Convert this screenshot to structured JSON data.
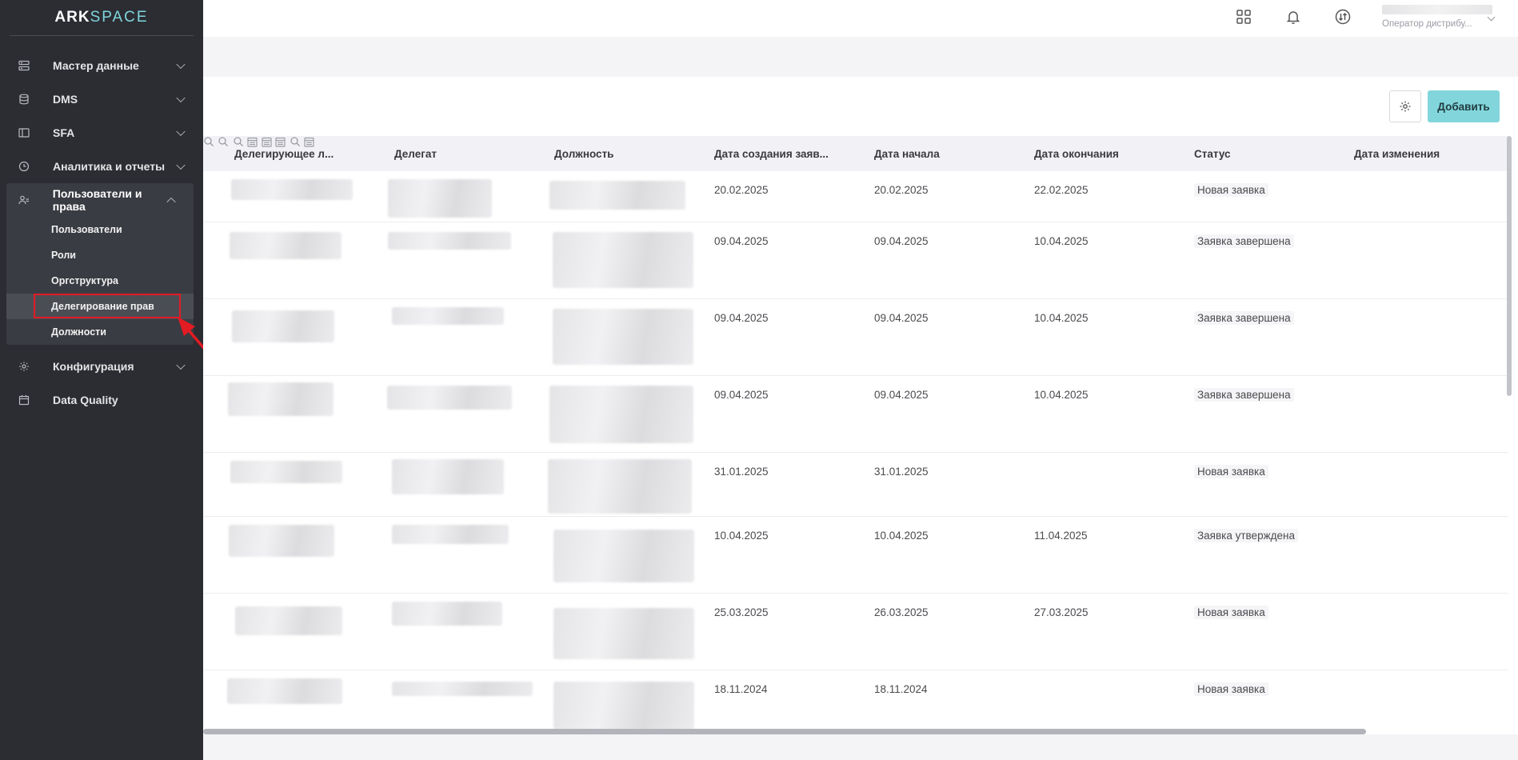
{
  "logo": {
    "part1": "ARK",
    "part2": "SPACE"
  },
  "sidebar": {
    "items": [
      {
        "label": "Мастер данные",
        "icon": "server-icon"
      },
      {
        "label": "DMS",
        "icon": "database-icon"
      },
      {
        "label": "SFA",
        "icon": "sidebar-layout-icon"
      },
      {
        "label": "Аналитика и отчеты",
        "icon": "clock-icon"
      }
    ],
    "group": {
      "label": "Пользователи и права",
      "icon": "users-icon",
      "children": [
        "Пользователи",
        "Роли",
        "Оргструктура",
        "Делегирование прав",
        "Должности"
      ]
    },
    "after": [
      {
        "label": "Конфигурация",
        "icon": "gear-icon"
      },
      {
        "label": "Data Quality",
        "icon": "calendar-icon"
      }
    ]
  },
  "header": {
    "icons": [
      "apps-grid-icon",
      "bell-icon",
      "sync-icon"
    ],
    "user_role": "Оператор дистрибу..."
  },
  "toolbar": {
    "add_label": "Добавить",
    "settings_icon": "gear-icon"
  },
  "table": {
    "columns": [
      "Делегирующее л...",
      "Делегат",
      "Должность",
      "Дата создания заяв...",
      "Дата начала",
      "Дата окончания",
      "Статус",
      "Дата изменения"
    ],
    "rows": [
      {
        "created": "20.02.2025",
        "start": "20.02.2025",
        "end": "22.02.2025",
        "status": "Новая заявка"
      },
      {
        "created": "09.04.2025",
        "start": "09.04.2025",
        "end": "10.04.2025",
        "status": "Заявка завершена"
      },
      {
        "created": "09.04.2025",
        "start": "09.04.2025",
        "end": "10.04.2025",
        "status": "Заявка завершена"
      },
      {
        "created": "09.04.2025",
        "start": "09.04.2025",
        "end": "10.04.2025",
        "status": "Заявка завершена"
      },
      {
        "created": "31.01.2025",
        "start": "31.01.2025",
        "end": "",
        "status": "Новая заявка"
      },
      {
        "created": "10.04.2025",
        "start": "10.04.2025",
        "end": "11.04.2025",
        "status": "Заявка утверждена"
      },
      {
        "created": "25.03.2025",
        "start": "26.03.2025",
        "end": "27.03.2025",
        "status": "Новая заявка"
      },
      {
        "created": "18.11.2024",
        "start": "18.11.2024",
        "end": "",
        "status": "Новая заявка"
      }
    ]
  },
  "colors": {
    "sidebar_bg": "#2b2d33",
    "accent": "#82d6db",
    "highlight": "#e31b23"
  }
}
